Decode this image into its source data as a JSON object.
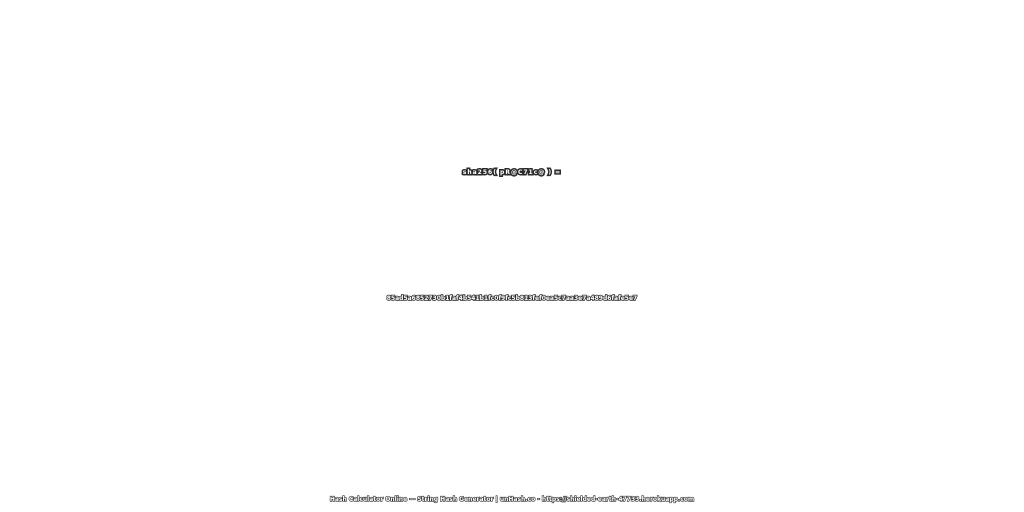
{
  "headline": "sha256( pR@C71c@ ) =",
  "hash_value": "85ad5a6852730b1faf4b541b1fc0f9fc5b813fef0ea5c7aa3e7a489d6fafe5e7",
  "footer": "Hash Calculator Online — String Hash Generator | unHash.co - https://shielded-earth-47733.herokuapp.com",
  "colors": {
    "background": "#ffffff",
    "text_fill": "#ffffff",
    "text_outline": "#2a2a2a"
  }
}
